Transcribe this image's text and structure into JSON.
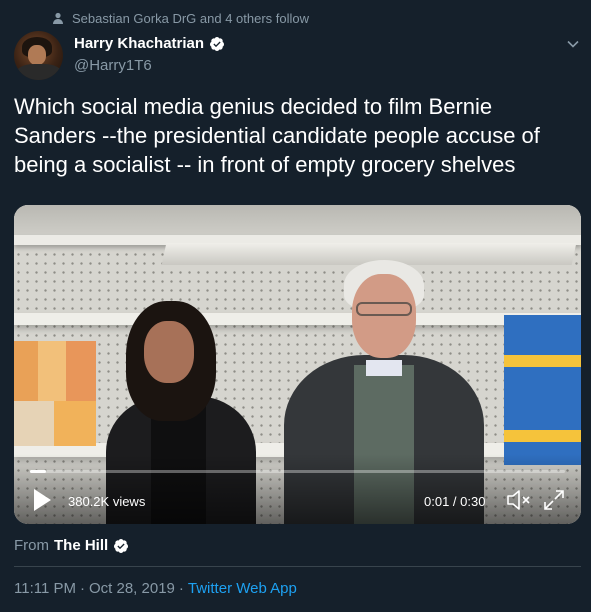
{
  "social_context": {
    "text": "Sebastian Gorka DrG and 4 others follow",
    "icon": "person-icon"
  },
  "author": {
    "name": "Harry Khachatrian",
    "handle": "@Harry1T6",
    "verified": true
  },
  "tweet": {
    "text": "Which social media genius decided to film Bernie Sanders --the presidential candidate people accuse of being a socialist -- in front of empty grocery shelves"
  },
  "video": {
    "views": "380.2K views",
    "time": "0:01 / 0:30",
    "progress": 0.03
  },
  "attribution": {
    "label": "From",
    "source": "The Hill",
    "verified": true
  },
  "meta": {
    "time": "11:11 PM",
    "separator": "·",
    "date": "Oct 28, 2019",
    "app": "Twitter Web App"
  },
  "colors": {
    "background": "#15202b",
    "secondary_text": "#8899a6",
    "accent": "#1da1f2",
    "divider": "#38444d"
  }
}
